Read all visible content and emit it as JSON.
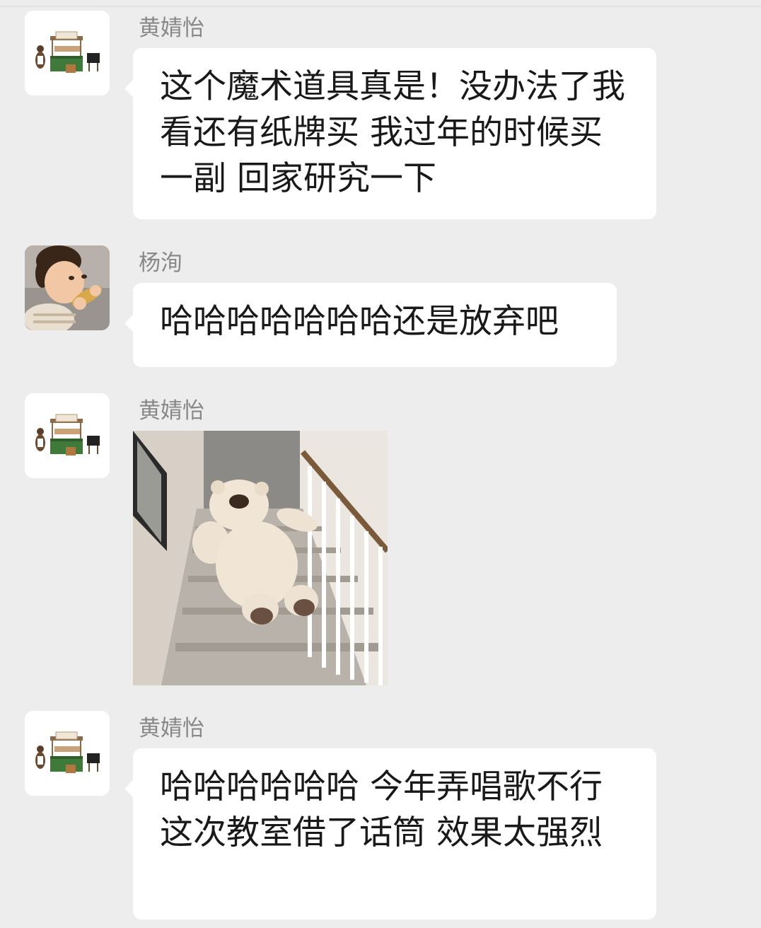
{
  "chat": {
    "messages": [
      {
        "sender": "黄婧怡",
        "avatar_icon": "lemonade-stand-bear-icon",
        "type": "text",
        "text": "这个魔术道具真是！没办法了我看还有纸牌买 我过年的时候买一副 回家研究一下"
      },
      {
        "sender": "杨洵",
        "avatar_icon": "child-eating-photo-icon",
        "type": "text",
        "text": "哈哈哈哈哈哈哈还是放弃吧"
      },
      {
        "sender": "黄婧怡",
        "avatar_icon": "lemonade-stand-bear-icon",
        "type": "sticker",
        "sticker_icon": "teddy-bear-sliding-down-stairs-icon"
      },
      {
        "sender": "黄婧怡",
        "avatar_icon": "lemonade-stand-bear-icon",
        "type": "text",
        "text": "哈哈哈哈哈哈 今年弄唱歌不行  这次教室借了话筒 效果太强烈"
      }
    ]
  },
  "colors": {
    "background": "#ededed",
    "bubble": "#ffffff",
    "sender_name": "#888888",
    "message_text": "#191919"
  }
}
